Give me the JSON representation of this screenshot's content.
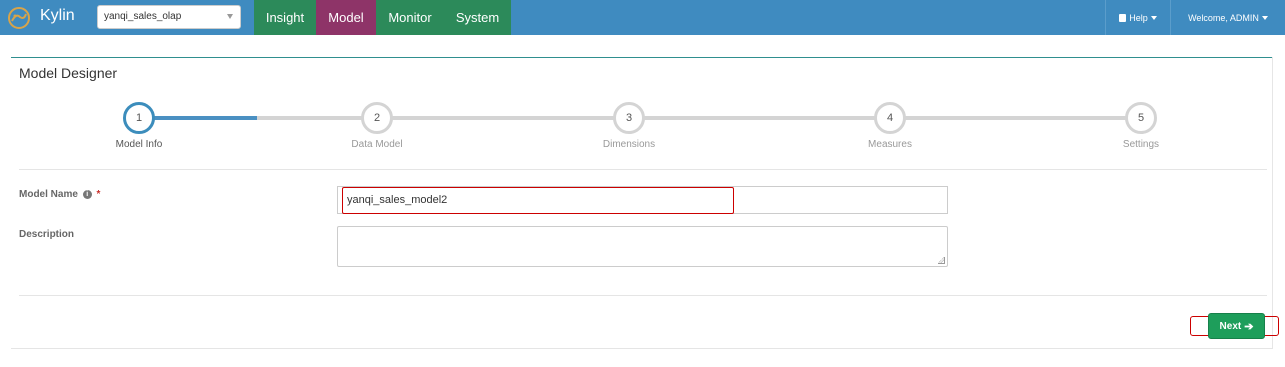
{
  "navbar": {
    "brand": "Kylin",
    "project": "yanqi_sales_olap",
    "tabs": [
      {
        "label": "Insight"
      },
      {
        "label": "Model"
      },
      {
        "label": "Monitor"
      },
      {
        "label": "System"
      }
    ],
    "active_tab": "Model",
    "help": "Help",
    "welcome": "Welcome, ADMIN"
  },
  "page": {
    "title": "Model Designer"
  },
  "steps": [
    {
      "number": "1",
      "label": "Model Info"
    },
    {
      "number": "2",
      "label": "Data Model"
    },
    {
      "number": "3",
      "label": "Dimensions"
    },
    {
      "number": "4",
      "label": "Measures"
    },
    {
      "number": "5",
      "label": "Settings"
    }
  ],
  "active_step": 1,
  "form": {
    "model_name_label": "Model Name",
    "required_mark": "*",
    "model_name_value": "yanqi_sales_model2",
    "description_label": "Description",
    "description_value": ""
  },
  "actions": {
    "next_label": "Next"
  },
  "colors": {
    "navbar": "#3f8bc0",
    "tab_green": "#2c8a5a",
    "tab_active": "#8e3468",
    "step_active": "#3c8dbc",
    "next_button": "#1e9e5b",
    "highlight": "#cc0000"
  },
  "icons": {
    "logo": "kylin-logo-icon",
    "select_caret": "chevron-down-icon",
    "help": "book-icon",
    "info": "info-icon",
    "next_arrow": "arrow-right-icon"
  }
}
